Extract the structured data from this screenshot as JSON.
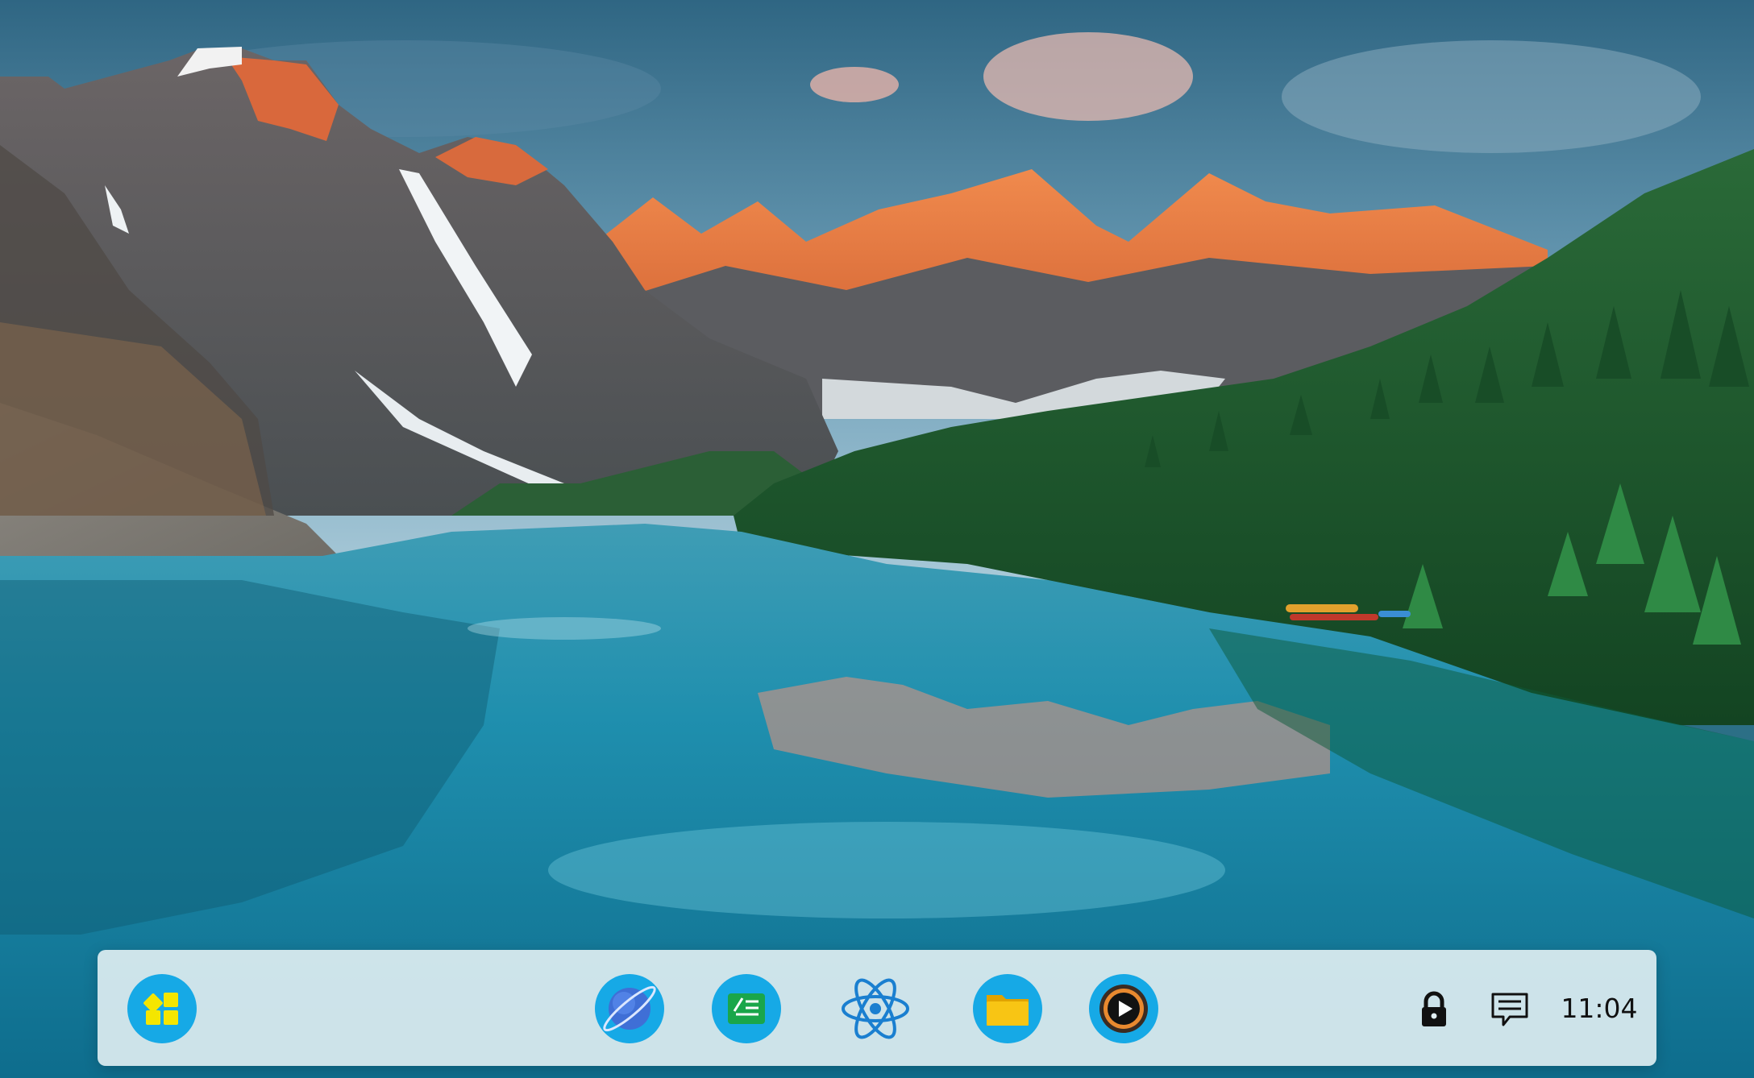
{
  "wallpaper": {
    "scene": "mountain-lake",
    "colors": {
      "sky_top": "#3b7391",
      "sky_bottom": "#9fc4d6",
      "peak_glow": "#e7683a",
      "rock": "#5c5a5a",
      "forest": "#1f5a2c",
      "lake": "#1d8aa8"
    }
  },
  "taskbar": {
    "background": "#e2eff3",
    "start": {
      "icon": "grid-tiles-icon",
      "color": "#f4e600",
      "bg": "#16a9e6"
    },
    "apps": [
      {
        "id": "browser",
        "icon": "planet-icon"
      },
      {
        "id": "editor",
        "icon": "note-edit-icon"
      },
      {
        "id": "react",
        "icon": "atom-icon"
      },
      {
        "id": "files",
        "icon": "folder-icon"
      },
      {
        "id": "media",
        "icon": "play-icon"
      }
    ],
    "tray": {
      "lock_icon": "lock-icon",
      "chat_icon": "chat-bubble-icon",
      "clock": "11:04"
    }
  }
}
